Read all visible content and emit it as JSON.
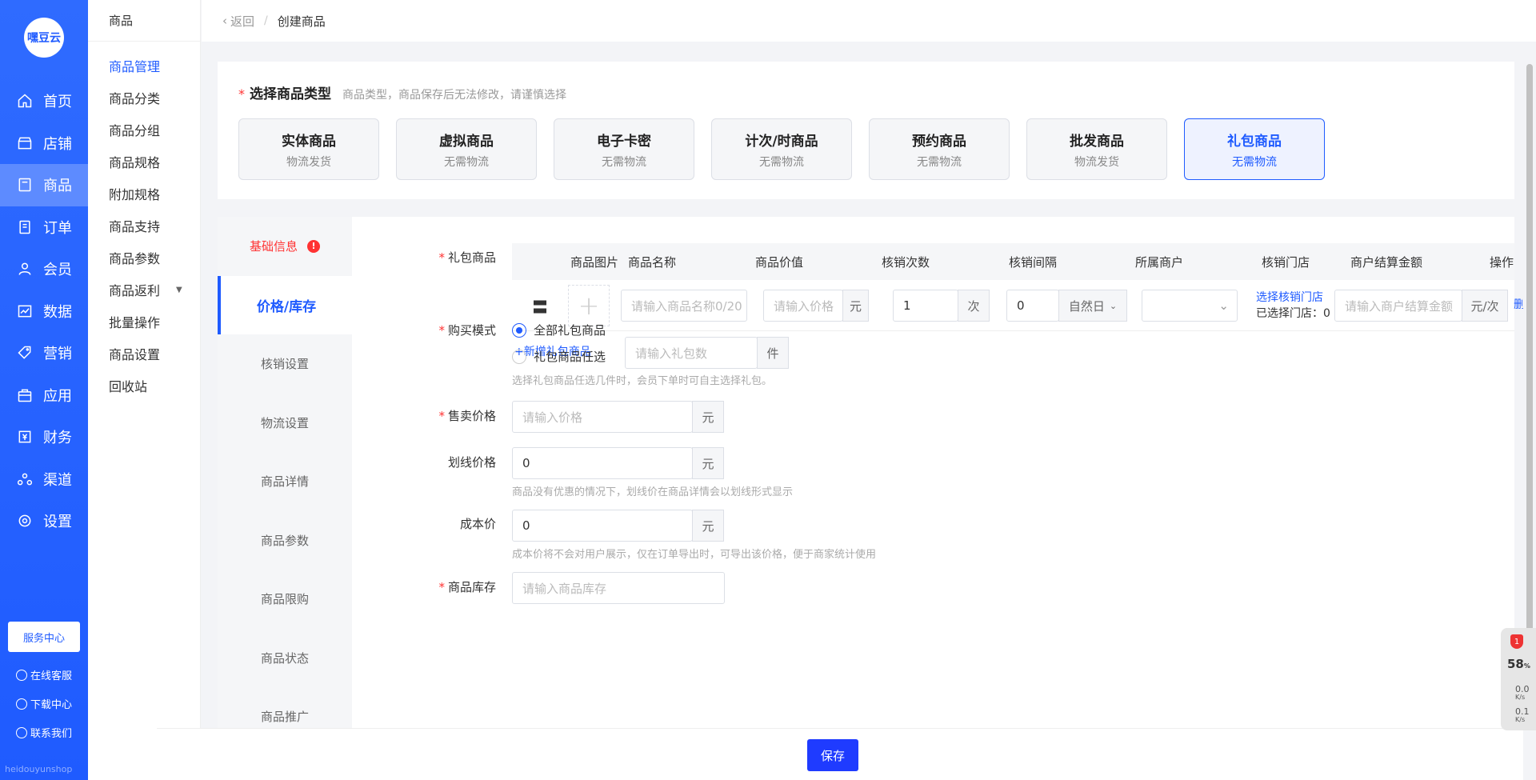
{
  "logo": {
    "text": "嘿豆云"
  },
  "nav": [
    {
      "label": "首页",
      "icon": "home-icon"
    },
    {
      "label": "店铺",
      "icon": "store-icon"
    },
    {
      "label": "商品",
      "icon": "product-icon"
    },
    {
      "label": "订单",
      "icon": "order-icon"
    },
    {
      "label": "会员",
      "icon": "member-icon"
    },
    {
      "label": "数据",
      "icon": "data-icon"
    },
    {
      "label": "营销",
      "icon": "tag-icon"
    },
    {
      "label": "应用",
      "icon": "app-icon"
    },
    {
      "label": "财务",
      "icon": "finance-icon"
    },
    {
      "label": "渠道",
      "icon": "channel-icon"
    },
    {
      "label": "设置",
      "icon": "gear-icon"
    }
  ],
  "sidebar_footer": {
    "service_center": "服务中心",
    "online_service": "在线客服",
    "download_center": "下载中心",
    "contact_us": "联系我们",
    "brand": "heidouyunshop"
  },
  "subside": {
    "title": "商品",
    "items": [
      "商品管理",
      "商品分类",
      "商品分组",
      "商品规格",
      "附加规格",
      "商品支持",
      "商品参数",
      "商品返利",
      "批量操作",
      "商品设置",
      "回收站"
    ]
  },
  "breadcrumb": {
    "back": "返回",
    "sep": "/",
    "current": "创建商品"
  },
  "type_section": {
    "title": "选择商品类型",
    "hint": "商品类型，商品保存后无法修改，请谨慎选择",
    "types": [
      {
        "name": "实体商品",
        "sub": "物流发货"
      },
      {
        "name": "虚拟商品",
        "sub": "无需物流"
      },
      {
        "name": "电子卡密",
        "sub": "无需物流"
      },
      {
        "name": "计次/时商品",
        "sub": "无需物流"
      },
      {
        "name": "预约商品",
        "sub": "无需物流"
      },
      {
        "name": "批发商品",
        "sub": "物流发货"
      },
      {
        "name": "礼包商品",
        "sub": "无需物流"
      }
    ]
  },
  "tabs": [
    "基础信息",
    "价格/库存",
    "核销设置",
    "物流设置",
    "商品详情",
    "商品参数",
    "商品限购",
    "商品状态",
    "商品推广"
  ],
  "gift": {
    "label": "礼包商品",
    "headers": [
      "商品图片",
      "商品名称",
      "商品价值",
      "核销次数",
      "核销间隔",
      "所属商户",
      "核销门店",
      "商户结算金额",
      "操作"
    ],
    "row": {
      "name_placeholder": "请输入商品名称0/20",
      "price_placeholder": "请输入价格",
      "yuan": "元",
      "count": "1",
      "count_unit": "次",
      "interval": "0",
      "interval_unit": "自然日",
      "select_store": "选择核销门店",
      "selected_store": "已选择门店：0",
      "settle_placeholder": "请输入商户结算金额",
      "settle_unit": "元/次",
      "delete": "删除"
    },
    "add_link": "+新增礼包商品"
  },
  "buy_mode": {
    "label": "购买模式",
    "opt_all": "全部礼包商品",
    "opt_choose": "礼包商品任选",
    "count_placeholder": "请输入礼包数",
    "unit": "件",
    "tip": "选择礼包商品任选几件时，会员下单时可自主选择礼包。"
  },
  "sale_price": {
    "label": "售卖价格",
    "placeholder": "请输入价格",
    "unit": "元"
  },
  "line_price": {
    "label": "划线价格",
    "value": "0",
    "unit": "元",
    "tip": "商品没有优惠的情况下，划线价在商品详情会以划线形式显示"
  },
  "cost_price": {
    "label": "成本价",
    "value": "0",
    "unit": "元",
    "tip": "成本价将不会对用户展示，仅在订单导出时，可导出该价格，便于商家统计使用"
  },
  "stock": {
    "label": "商品库存",
    "placeholder": "请输入商品库存"
  },
  "save": "保存",
  "widget": {
    "badge": "1",
    "percent": "58",
    "percent_unit": "%",
    "up": "0.0",
    "down": "0.1",
    "unit": "K/s"
  }
}
